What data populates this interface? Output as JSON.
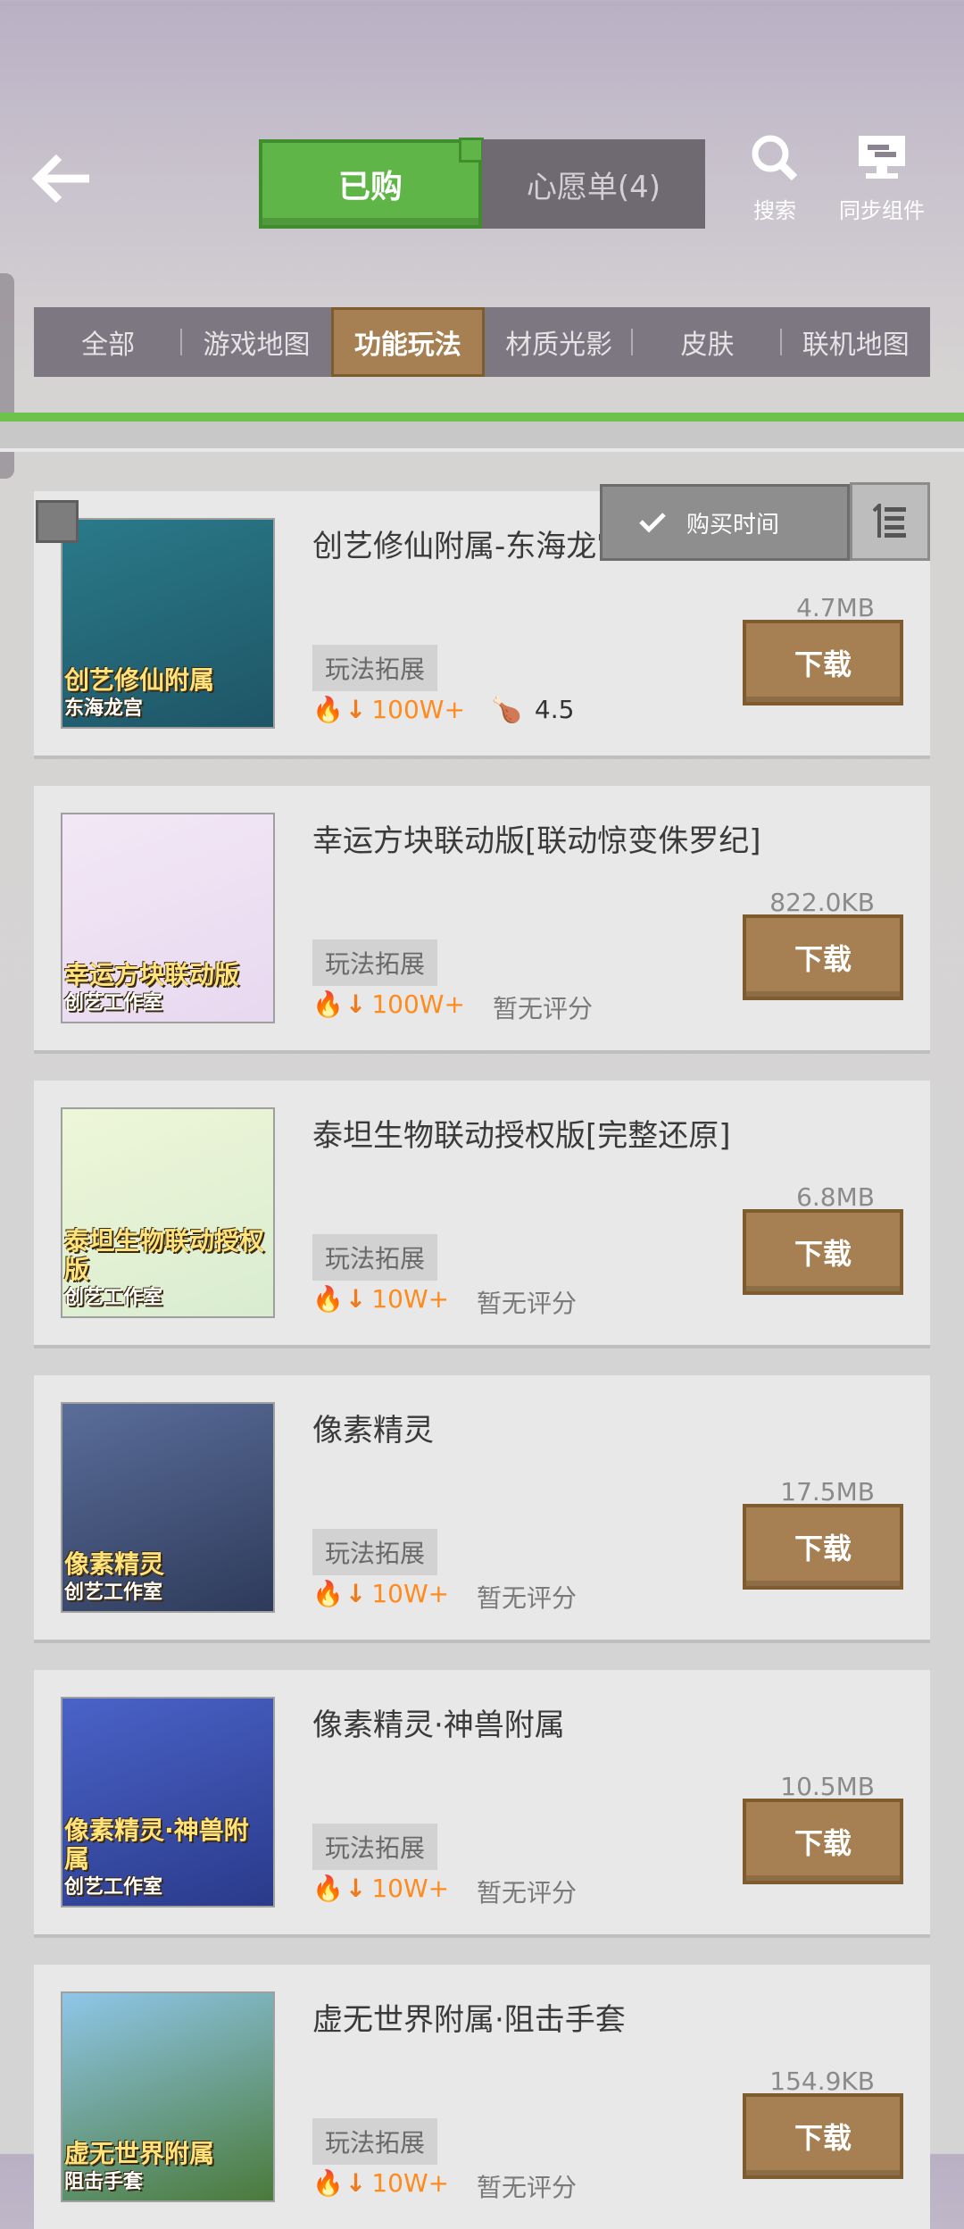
{
  "header": {
    "tabs": [
      "已购",
      "心愿单(4)"
    ],
    "search_label": "搜索",
    "sync_label": "同步组件"
  },
  "categories": [
    "全部",
    "游戏地图",
    "功能玩法",
    "材质光影",
    "皮肤",
    "联机地图"
  ],
  "active_category": "功能玩法",
  "sort": {
    "label": "购买时间"
  },
  "items": [
    {
      "title": "创艺修仙附属-东海龙宫",
      "size": "4.7MB",
      "tag": "玩法拓展",
      "downloads": "100W+",
      "rating": "4.5",
      "download_label": "下载",
      "thumb_line1": "创艺修仙附属",
      "thumb_line2": "东海龙宫",
      "thumb_colors": [
        "#2a7a8a",
        "#1e5566"
      ]
    },
    {
      "title": "幸运方块联动版[联动惊变侏罗纪]",
      "size": "822.0KB",
      "tag": "玩法拓展",
      "downloads": "100W+",
      "rating": "暂无评分",
      "download_label": "下载",
      "thumb_line1": "幸运方块联动版",
      "thumb_line2": "创艺工作室",
      "thumb_colors": [
        "#f2e8f5",
        "#e8d8f0"
      ]
    },
    {
      "title": "泰坦生物联动授权版[完整还原]",
      "size": "6.8MB",
      "tag": "玩法拓展",
      "downloads": "10W+",
      "rating": "暂无评分",
      "download_label": "下载",
      "thumb_line1": "泰坦生物联动授权版",
      "thumb_line2": "创艺工作室",
      "thumb_colors": [
        "#eef6d8",
        "#d9ecd0"
      ]
    },
    {
      "title": "像素精灵",
      "size": "17.5MB",
      "tag": "玩法拓展",
      "downloads": "10W+",
      "rating": "暂无评分",
      "download_label": "下载",
      "thumb_line1": "像素精灵",
      "thumb_line2": "创艺工作室",
      "thumb_colors": [
        "#5a6e9a",
        "#2e3a5a"
      ]
    },
    {
      "title": "像素精灵·神兽附属",
      "size": "10.5MB",
      "tag": "玩法拓展",
      "downloads": "10W+",
      "rating": "暂无评分",
      "download_label": "下载",
      "thumb_line1": "像素精灵·神兽附属",
      "thumb_line2": "创艺工作室",
      "thumb_colors": [
        "#4a63c8",
        "#2a3a8a"
      ]
    },
    {
      "title": "虚无世界附属·阻击手套",
      "size": "154.9KB",
      "tag": "玩法拓展",
      "downloads": "10W+",
      "rating": "暂无评分",
      "download_label": "下载",
      "thumb_line1": "虚无世界附属",
      "thumb_line2": "阻击手套",
      "thumb_colors": [
        "#8fc6e8",
        "#4a7a3a"
      ]
    }
  ]
}
